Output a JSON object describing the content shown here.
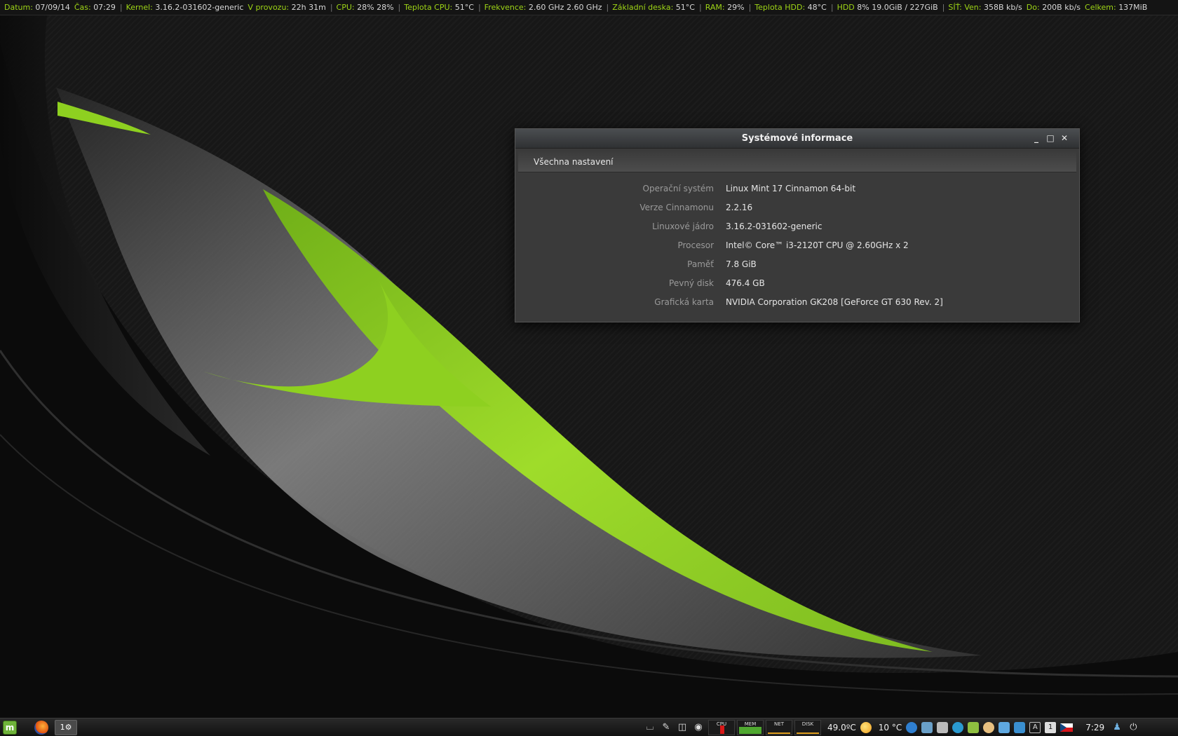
{
  "conky": {
    "datum_label": "Datum:",
    "datum": "07/09/14",
    "cas_label": "Čas:",
    "cas": "07:29",
    "kernel_label": "Kernel:",
    "kernel": "3.16.2-031602-generic",
    "uptime_label": "V provozu:",
    "uptime": "22h 31m",
    "cpu_label": "CPU:",
    "cpu": "28% 28%",
    "cputemp_label": "Teplota CPU:",
    "cputemp": "51°C",
    "freq_label": "Frekvence:",
    "freq": "2.60 GHz 2.60 GHz",
    "mb_label": "Základní deska:",
    "mb": "51°C",
    "ram_label": "RAM:",
    "ram": "29%",
    "hddtemp_label": "Teplota HDD:",
    "hddtemp": "48°C",
    "hdd_label": "HDD",
    "hdd": "8% 19.0GiB / 227GiB",
    "net_label": "SÍŤ: Ven:",
    "net_up": "358B   kb/s",
    "net_down_label": "Do:",
    "net_down": "200B   kb/s",
    "total_label": "Celkem:",
    "total": "137MiB"
  },
  "window": {
    "title": "Systémové informace",
    "all_settings": "Všechna nastavení",
    "info": [
      {
        "key": "Operační systém",
        "value": "Linux Mint 17 Cinnamon 64-bit"
      },
      {
        "key": "Verze Cinnamonu",
        "value": "2.2.16"
      },
      {
        "key": "Linuxové jádro",
        "value": "3.16.2-031602-generic"
      },
      {
        "key": "Procesor",
        "value": "Intel© Core™ i3-2120T CPU @ 2.60GHz x 2"
      },
      {
        "key": "Paměť",
        "value": "7.8 GiB"
      },
      {
        "key": "Pevný disk",
        "value": "476.4 GB"
      },
      {
        "key": "Grafická karta",
        "value": "NVIDIA Corporation GK208 [GeForce GT 630 Rev. 2]"
      }
    ]
  },
  "panel": {
    "task_label": "1",
    "graphs": {
      "cpu": "CPU",
      "mem": "MEM",
      "net": "NET",
      "disk": "DISK"
    },
    "temp": "49.0ºC",
    "weather": "10 °C",
    "keyboard_label": "A",
    "workspace": "1",
    "clock": "7:29"
  },
  "colors": {
    "accent": "#9ed516",
    "window_bg": "#3a3a3a",
    "panel_bg": "#1a1a1a"
  }
}
